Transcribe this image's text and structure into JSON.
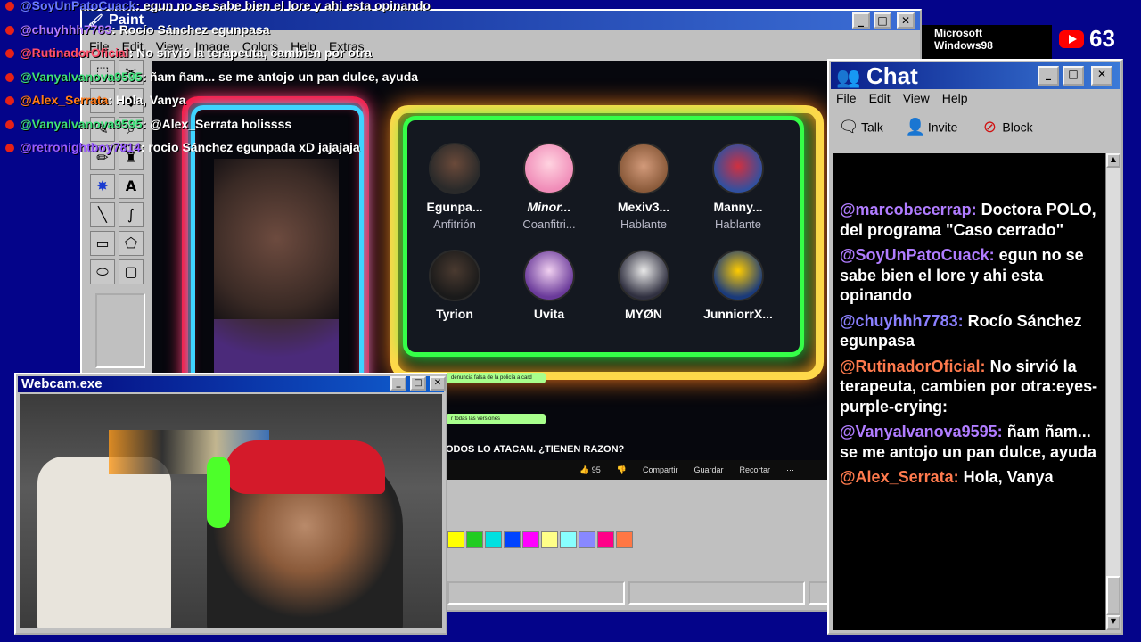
{
  "overlay_chat": [
    {
      "user": "@SoyUnPatoCuack",
      "text": ": egun no se sabe bien el lore y ahi esta opinando",
      "color": "#6a7bff"
    },
    {
      "user": "@chuyhhh7783",
      "text": ": Rocío Sánchez egunpasa",
      "color": "#b47cff"
    },
    {
      "user": "@RutinadorOficial",
      "text": ": No sirvió la terapeuta, cambien por otra",
      "color": "#ff4f6b"
    },
    {
      "user": "@VanyaIvanova9595",
      "text": ": ñam ñam... se me antojo un pan dulce, ayuda",
      "color": "#3fe07a"
    },
    {
      "user": "@Alex_Serrata",
      "text": ": Hola, Vanya",
      "color": "#ff7a1a"
    },
    {
      "user": "@VanyaIvanova9595",
      "text": ": @Alex_Serrata holissss",
      "color": "#3fe07a"
    },
    {
      "user": "@retronightboy7814",
      "text": ": rocio Sánchez egunpada xD jajajaja",
      "color": "#9a5cff"
    }
  ],
  "paint": {
    "title": "Paint",
    "menu": [
      "File",
      "Edit",
      "View",
      "Image",
      "Colors",
      "Help",
      "Extras"
    ],
    "palette": [
      "#ffff00",
      "#22cc22",
      "#00e0e0",
      "#0044ff",
      "#ff00ff",
      "#ffff88",
      "#88ffff",
      "#8888ff",
      "#ff0088",
      "#ff7744"
    ]
  },
  "stream": {
    "members": [
      {
        "name": "Egunpa...",
        "role": "Anfitrión"
      },
      {
        "name": "Minor...",
        "role": "Coanfitri..."
      },
      {
        "name": "Mexiv3...",
        "role": "Hablante"
      },
      {
        "name": "Manny...",
        "role": "Hablante"
      },
      {
        "name": "Tyrion",
        "role": ""
      },
      {
        "name": "Uvita",
        "role": ""
      },
      {
        "name": "MYØN",
        "role": ""
      },
      {
        "name": "JunniorrX...",
        "role": ""
      }
    ],
    "video_title": "ODOS LO ATACAN. ¿TIENEN RAZON?",
    "bubble_1": "denuncia falsa de la policía a card",
    "bubble_2": "r todas las versiones",
    "likes": "95",
    "actions": [
      "Compartir",
      "Guardar",
      "Recortar"
    ]
  },
  "webcam": {
    "title": "Webcam.exe"
  },
  "chat": {
    "title": "Chat",
    "menu": [
      "File",
      "Edit",
      "View",
      "Help"
    ],
    "toolbar": [
      "Talk",
      "Invite",
      "Block"
    ],
    "messages": [
      {
        "user": "@marcobecerrap:",
        "text": "Doctora POLO, del programa \"Caso cerrado\"",
        "color": "#b07cff"
      },
      {
        "user": "@SoyUnPatoCuack:",
        "text": "egun no se sabe bien el lore y ahi esta opinando",
        "color": "#b07cff"
      },
      {
        "user": "@chuyhhh7783:",
        "text": "Rocío Sánchez egunpasa",
        "color": "#8b80ff"
      },
      {
        "user": "@RutinadorOficial:",
        "text": "No sirvió la terapeuta, cambien por otra:eyes-purple-crying:",
        "color": "#ff7a4d"
      },
      {
        "user": "@VanyaIvanova9595:",
        "text": "ñam ñam... se me antojo un pan dulce, ayuda",
        "color": "#b07cff"
      },
      {
        "user": "@Alex_Serrata:",
        "text": "Hola, Vanya",
        "color": "#ff7a4d"
      }
    ]
  },
  "youtube_count": "63",
  "taskbar_text": "Microsoft Windows98"
}
